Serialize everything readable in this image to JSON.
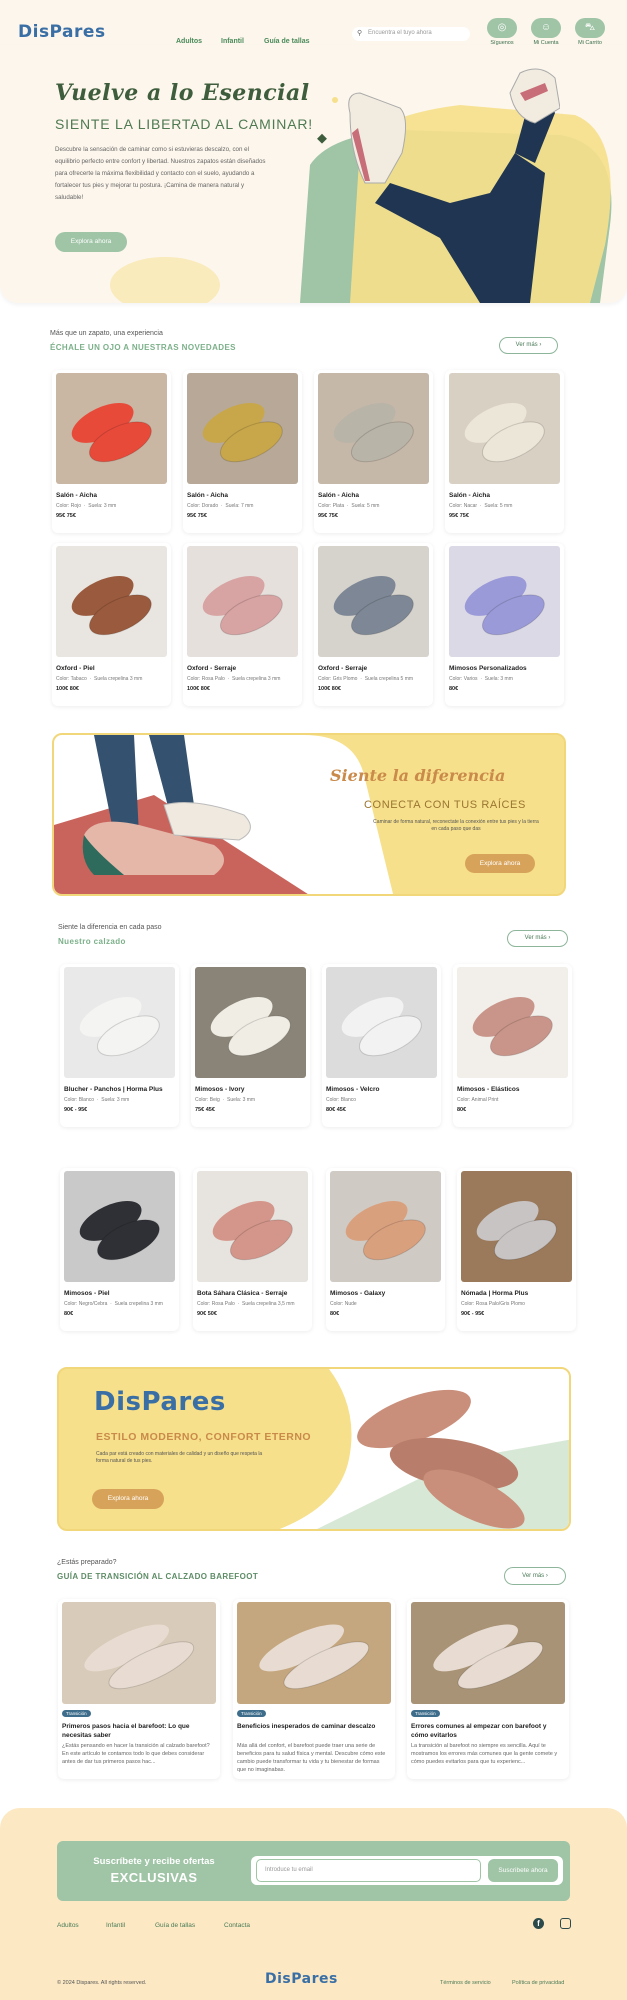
{
  "header": {
    "logo": "DisPares",
    "nav": [
      "Adultos",
      "Infantil",
      "Guía de tallas"
    ],
    "search_placeholder": "Encuentra el tuyo ahora",
    "icons": [
      {
        "label": "Síguenos",
        "icon": "instagram-icon"
      },
      {
        "label": "Mi Cuenta",
        "icon": "user-icon"
      },
      {
        "label": "Mi Carrito",
        "icon": "cart-icon"
      }
    ]
  },
  "hero": {
    "title": "Vuelve a lo Esencial",
    "subtitle": "SIENTE LA LIBERTAD AL CAMINAR!",
    "text": "Descubre la sensación de caminar como si estuvieras descalzo, con el equilibrio perfecto entre confort y libertad. Nuestros zapatos están diseñados para ofrecerte la máxima flexibilidad y contacto con el suelo, ayudando a fortalecer tus pies y mejorar tu postura. ¡Camina de manera natural y saludable!",
    "button": "Explora ahora"
  },
  "novedades": {
    "kicker": "Más que un zapato, una experiencia",
    "title": "ÉCHALE UN OJO A NUESTRAS NOVEDADES",
    "button": "Ver más",
    "products": [
      {
        "name": "Salón - Aicha",
        "color": "Rojo",
        "suela": "3 mm",
        "price": "95€ 75€"
      },
      {
        "name": "Salón - Aicha",
        "color": "Dorado",
        "suela": "7 mm",
        "price": "95€ 75€"
      },
      {
        "name": "Salón - Aicha",
        "color": "Plata",
        "suela": "5 mm",
        "price": "95€ 75€"
      },
      {
        "name": "Salón - Aicha",
        "color": "Nacar",
        "suela": "5 mm",
        "price": "95€ 75€"
      },
      {
        "name": "Oxford - Piel",
        "color": "Tabaco",
        "suela": "Suela crepelina 3 mm",
        "price": "100€ 80€"
      },
      {
        "name": "Oxford - Serraje",
        "color": "Rosa Palo",
        "suela": "Suela crepelina 3 mm",
        "price": "100€ 80€"
      },
      {
        "name": "Oxford - Serraje",
        "color": "Gris Plomo",
        "suela": "Suela crepelina 5 mm",
        "price": "100€ 80€"
      },
      {
        "name": "Mimosos Personalizados",
        "color": "Varios",
        "suela": "3 mm",
        "price": "80€"
      }
    ]
  },
  "banner1": {
    "title": "Siente la diferencia",
    "subtitle": "CONECTA CON TUS RAÍCES",
    "text": "Caminar de forma natural, reconectate la conexión entre tus pies y la tierra en cada paso que das",
    "button": "Explora ahora"
  },
  "calzado": {
    "kicker": "Siente la diferencia en cada paso",
    "title": "Nuestro calzado",
    "button": "Ver más",
    "products": [
      {
        "name": "Blucher - Panchos | Horma Plus",
        "color": "Blanco",
        "suela": "3 mm",
        "price": "90€ - 95€"
      },
      {
        "name": "Mimosos - Ivory",
        "color": "Beig",
        "suela": "3 mm",
        "price": "75€ 45€"
      },
      {
        "name": "Mimosos - Velcro",
        "color": "Blanco",
        "suela": "",
        "price": "80€ 45€"
      },
      {
        "name": "Mimosos - Elásticos",
        "color": "Animal Print",
        "suela": "",
        "price": "80€"
      },
      {
        "name": "Mimosos - Piel",
        "color": "Negro/Cebra",
        "suela": "Suela crepelina 3 mm",
        "price": "80€"
      },
      {
        "name": "Bota Sáhara Clásica - Serraje",
        "color": "Rosa Palo",
        "suela": "Suela crepelina 3,5 mm",
        "price": "90€ 50€"
      },
      {
        "name": "Mimosos - Galaxy",
        "color": "Nude",
        "suela": "",
        "price": "80€"
      },
      {
        "name": "Nómada | Horma Plus",
        "color": "Rosa Palo/Gris Plomo",
        "suela": "",
        "price": "90€ - 95€"
      }
    ]
  },
  "banner2": {
    "logo": "DisPares",
    "subtitle": "ESTILO MODERNO, CONFORT ETERNO",
    "text": "Cada par está creado con materiales de calidad y un diseño que respeta la forma natural de tus pies.",
    "button": "Explora ahora"
  },
  "guia": {
    "kicker": "¿Estás preparado?",
    "title": "GUÍA DE TRANSICIÓN AL CALZADO BAREFOOT",
    "button": "Ver más",
    "posts": [
      {
        "tag": "Transición",
        "title": "Primeros pasos hacia el barefoot: Lo que necesitas saber",
        "text": "¿Estás pensando en hacer la transición al calzado barefoot? En este artículo te contamos todo lo que debes considerar antes de dar tus primeros pasos hac..."
      },
      {
        "tag": "Transición",
        "title": "Beneficios inesperados de caminar descalzo",
        "text": "Más allá del confort, el barefoot puede traer una serie de beneficios para tu salud física y mental. Descubre cómo este cambio puede transformar tu vida y tu bienestar de formas que no imaginabas."
      },
      {
        "tag": "Transición",
        "title": "Errores comunes al empezar con barefoot y cómo evitarlos",
        "text": "La transición al barefoot no siempre es sencilla. Aquí te mostramos los errores más comunes que la gente comete y cómo puedes evitarlos para que tu experienc..."
      }
    ]
  },
  "newsletter": {
    "title": "Suscríbete y recibe ofertas",
    "title2": "EXCLUSIVAS",
    "placeholder": "Introduce tu email",
    "button": "Suscribete ahora"
  },
  "footer": {
    "links": [
      "Adultos",
      "Infantil",
      "Guía de tallas",
      "Contacta"
    ],
    "copyright": "© 2024 Dispares. All rights reserved.",
    "logo": "DisPares",
    "legal": [
      "Términos de servicio",
      "Política de privacidad"
    ]
  },
  "colors": {
    "green": "#9fc4a6",
    "yellow": "#f6e08b",
    "orange": "#d7a35a",
    "cream": "#fdf6ec"
  }
}
